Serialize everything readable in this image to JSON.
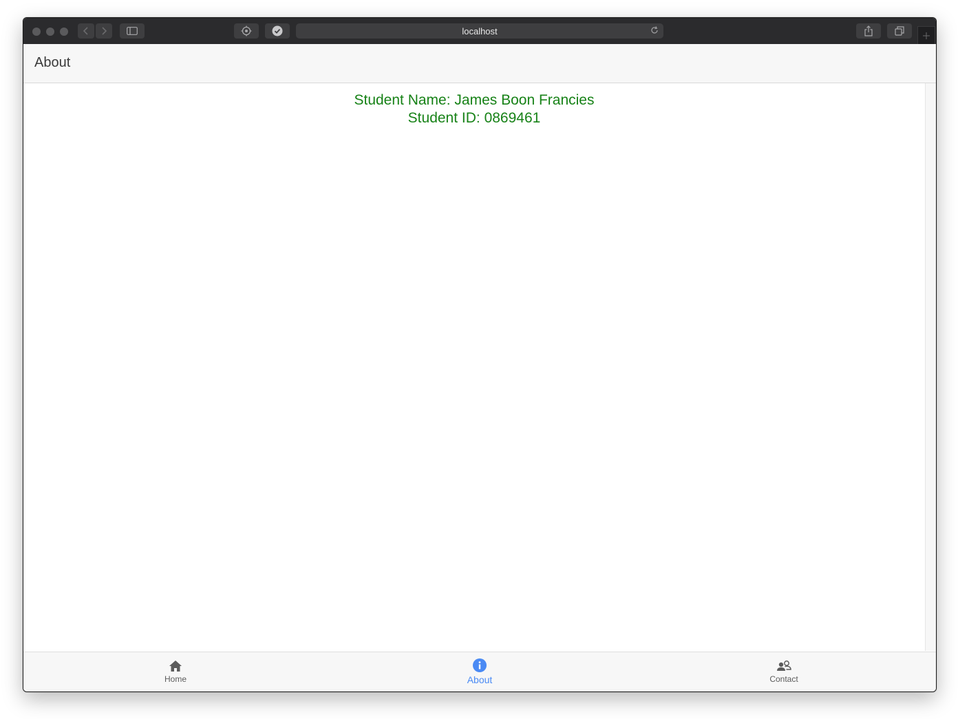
{
  "browser": {
    "url": "localhost"
  },
  "header": {
    "title": "About"
  },
  "content": {
    "student_name_line": "Student Name: James Boon Francies",
    "student_id_line": "Student ID: 0869461"
  },
  "tabs": [
    {
      "label": "Home",
      "icon": "home-icon"
    },
    {
      "label": "About",
      "icon": "info-icon",
      "active": true
    },
    {
      "label": "Contact",
      "icon": "contacts-icon"
    }
  ],
  "colors": {
    "accent": "#4a8af4",
    "student_text": "#178217"
  }
}
